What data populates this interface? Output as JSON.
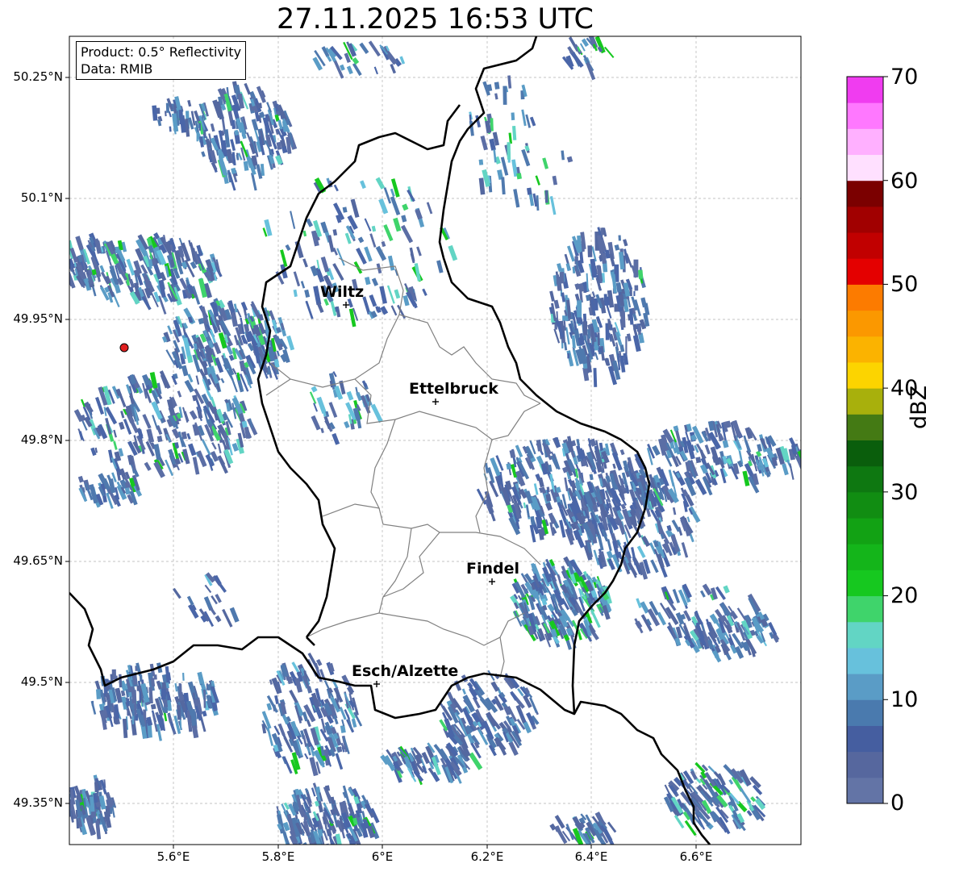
{
  "title": "27.11.2025 16:53 UTC",
  "info": {
    "product": "Product: 0.5° Reflectivity",
    "data": "Data: RMIB"
  },
  "axes": {
    "lat_labels": [
      "50.25°N",
      "50.1°N",
      "49.95°N",
      "49.8°N",
      "49.65°N",
      "49.5°N",
      "49.35°N"
    ],
    "lon_labels": [
      "5.6°E",
      "5.8°E",
      "6°E",
      "6.2°E",
      "6.4°E",
      "6.6°E"
    ]
  },
  "cities": [
    {
      "name": "Wiltz"
    },
    {
      "name": "Ettelbruck"
    },
    {
      "name": "Findel"
    },
    {
      "name": "Esch/Alzette"
    }
  ],
  "colorbar": {
    "label": "dBZ",
    "ticks": [
      "0",
      "10",
      "20",
      "30",
      "40",
      "50",
      "60",
      "70"
    ],
    "colors": [
      "#6374a6",
      "#56679e",
      "#455ea0",
      "#4a7aae",
      "#5a9cc6",
      "#67c1dc",
      "#62d5c4",
      "#3fd46b",
      "#16c81f",
      "#14b51a",
      "#12a214",
      "#118d12",
      "#0e7811",
      "#0a5e0c",
      "#447a14",
      "#a8b00c",
      "#fcd400",
      "#fbb300",
      "#fb9800",
      "#fc7b00",
      "#e40000",
      "#c10000",
      "#a10000",
      "#7b0000",
      "#ffe0ff",
      "#ffb0ff",
      "#ff78ff",
      "#f03cf0"
    ]
  },
  "colors": {
    "echo_main": "#5b6ea5",
    "border": "#000000",
    "canton": "#808080",
    "grid": "#b0b0b0",
    "radar_site": "#e02020"
  }
}
